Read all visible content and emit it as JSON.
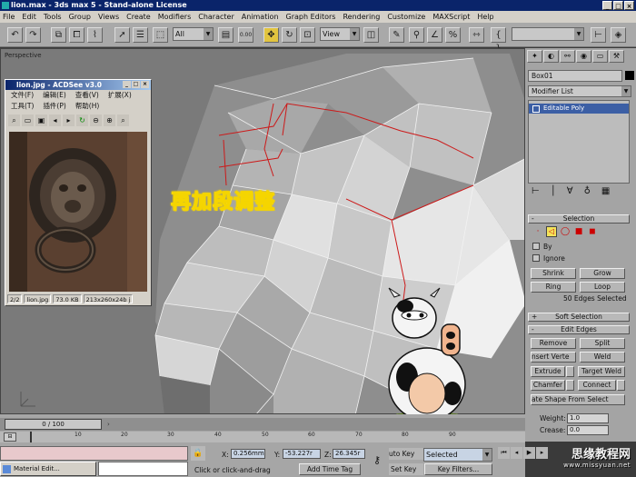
{
  "window": {
    "title": "lion.max - 3ds max 5 - Stand-alone License",
    "controls": [
      "_",
      "□",
      "×"
    ]
  },
  "menu": [
    "File",
    "Edit",
    "Tools",
    "Group",
    "Views",
    "Create",
    "Modifiers",
    "Character",
    "Animation",
    "Graph Editors",
    "Rendering",
    "Customize",
    "MAXScript",
    "Help"
  ],
  "toolbar": {
    "selection_filter": "All",
    "view_dropdown": "View",
    "snap_value": "0.00"
  },
  "viewport": {
    "label": "Perspective",
    "overlay_text": "再加段调整"
  },
  "acdsee": {
    "title": "lion.jpg - ACDSee v3.0",
    "menu": [
      "文件(F)",
      "编辑(E)",
      "查看(V)",
      "扩展(X)",
      "工具(T)",
      "插件(P)",
      "帮助(H)"
    ],
    "status": [
      "2/2",
      "lion.jpg",
      "73.0 KB",
      "213x260x24b j"
    ]
  },
  "panel": {
    "object_name": "Box01",
    "modifier_list": "Modifier List",
    "stack_item": "Editable Poly",
    "selection": {
      "title": "Selection",
      "by_label": "By",
      "ignore_label": "Ignore",
      "shrink": "Shrink",
      "grow": "Grow",
      "ring": "Ring",
      "loop": "Loop",
      "status": "50 Edges Selected"
    },
    "soft_selection": "Soft Selection",
    "edit_edges": {
      "title": "Edit Edges",
      "remove": "Remove",
      "split": "Split",
      "insert_vertex": "nsert Verte",
      "weld": "Weld",
      "extrude": "Extrude",
      "target_weld": "Target Weld",
      "chamfer": "Chamfer",
      "connect": "Connect",
      "create_shape": "ate Shape From Select",
      "weight_label": "Weight:",
      "weight_value": "1.0",
      "crease_label": "Crease:",
      "crease_value": "0.0"
    }
  },
  "timeline": {
    "frame": "0 / 100",
    "ticks": [
      "10",
      "20",
      "30",
      "40",
      "50",
      "60",
      "70",
      "80",
      "90"
    ]
  },
  "status": {
    "material_editor": "Material Edit...",
    "prompt": "Click or click-and-drag",
    "add_time_tag": "Add Time Tag",
    "x_label": "X:",
    "x_value": "0.256mm",
    "y_label": "Y:",
    "y_value": "-53.227r",
    "z_label": "Z:",
    "z_value": "26.345r",
    "auto_key": "uto Key",
    "auto_key_select": "Selected",
    "set_key": "Set Key",
    "key_filters": "Key Filters..."
  },
  "watermark": {
    "site": "思缘教程网",
    "url": "www.missyuan.net"
  }
}
